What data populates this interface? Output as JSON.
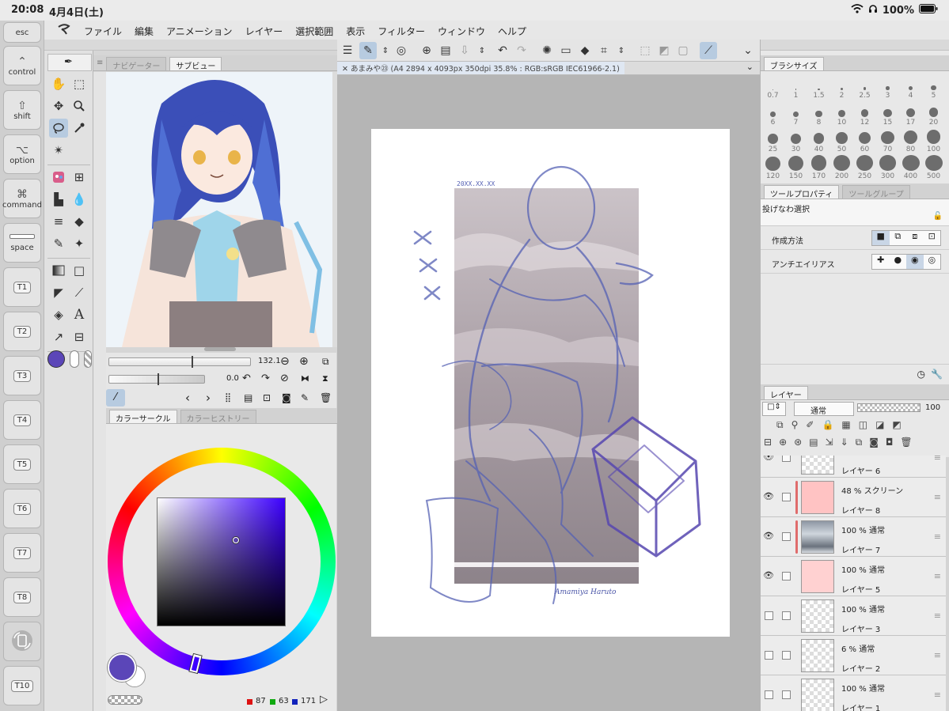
{
  "status": {
    "time": "20:08",
    "date": "4月4日(土)",
    "wifi_icon": "wifi-icon",
    "headphones_icon": "headphones-icon",
    "battery": "100%"
  },
  "edge_keys": [
    {
      "label": "esc",
      "glyph": "",
      "icon": "undo-circle-icon"
    },
    {
      "label": "control",
      "glyph": "⌃",
      "icon": "control-key-icon"
    },
    {
      "label": "shift",
      "glyph": "⇧",
      "icon": "shift-key-icon"
    },
    {
      "label": "option",
      "glyph": "⌥",
      "icon": "option-key-icon"
    },
    {
      "label": "command",
      "glyph": "⌘",
      "icon": "command-key-icon"
    },
    {
      "label": "space",
      "glyph": "",
      "icon": "space-key-icon"
    }
  ],
  "t_keys": [
    "T1",
    "T2",
    "T3",
    "T4",
    "T5",
    "T6",
    "T7",
    "T8",
    "T10"
  ],
  "menu": [
    "ファイル",
    "編集",
    "アニメーション",
    "レイヤー",
    "選択範囲",
    "表示",
    "フィルター",
    "ウィンドウ",
    "ヘルプ"
  ],
  "navigator": {
    "tab_navigator": "ナビゲーター",
    "tab_subview": "サブビュー",
    "zoom_value": "132.1",
    "rotate_value": "0.0"
  },
  "color_panel": {
    "tab_circle": "カラーサークル",
    "tab_history": "カラーヒストリー",
    "main_color": "#5b46b8",
    "rgb_r": "87",
    "rgb_g": "63",
    "rgb_b": "171"
  },
  "canvas": {
    "doc_title": "あまみや㉓ (A4 2894 x 4093px 350dpi 35.8% : RGB:sRGB IEC61966-2.1)"
  },
  "brush_size": {
    "tab": "ブラシサイズ",
    "sizes": [
      "0.7",
      "1",
      "1.5",
      "2",
      "2.5",
      "3",
      "4",
      "5",
      "6",
      "7",
      "8",
      "10",
      "12",
      "15",
      "17",
      "20",
      "25",
      "30",
      "40",
      "50",
      "60",
      "70",
      "80",
      "100",
      "120",
      "150",
      "170",
      "200",
      "250",
      "300",
      "400",
      "500"
    ]
  },
  "tool_property": {
    "tab": "ツールプロパティ",
    "tab_group": "ツールグループ",
    "tool_name": "投げなわ選択",
    "row_method": "作成方法",
    "row_antialias": "アンチエイリアス"
  },
  "layers": {
    "tab": "レイヤー",
    "blend_mode": "通常",
    "opacity": "100",
    "items": [
      {
        "mode": "",
        "name": "レイヤー 6",
        "visible": true,
        "clip": false
      },
      {
        "mode": "48 % スクリーン",
        "name": "レイヤー 8",
        "visible": true,
        "clip": true
      },
      {
        "mode": "100 % 通常",
        "name": "レイヤー 7",
        "visible": true,
        "clip": true
      },
      {
        "mode": "100 % 通常",
        "name": "レイヤー 5",
        "visible": true,
        "clip": false
      },
      {
        "mode": "100 % 通常",
        "name": "レイヤー 3",
        "visible": false,
        "clip": false
      },
      {
        "mode": "6 % 通常",
        "name": "レイヤー 2",
        "visible": false,
        "clip": false
      },
      {
        "mode": "100 % 通常",
        "name": "レイヤー 1",
        "visible": false,
        "clip": false
      }
    ]
  }
}
